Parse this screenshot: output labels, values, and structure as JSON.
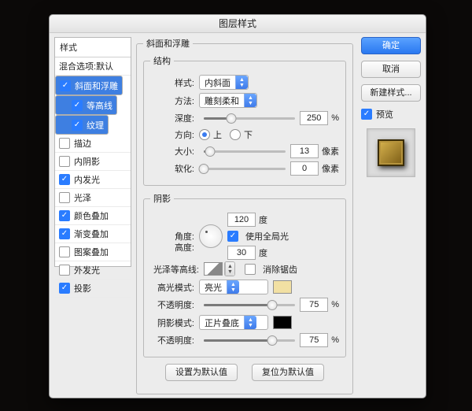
{
  "window": {
    "title": "图层样式"
  },
  "sidepanel": {
    "header": "样式",
    "blend": "混合选项:默认",
    "items": [
      {
        "label": "斜面和浮雕",
        "checked": true,
        "selected": true,
        "indent": false
      },
      {
        "label": "等高线",
        "checked": true,
        "selected": true,
        "indent": true
      },
      {
        "label": "纹理",
        "checked": true,
        "selected": true,
        "indent": true
      },
      {
        "label": "描边",
        "checked": false,
        "selected": false,
        "indent": false
      },
      {
        "label": "内阴影",
        "checked": false,
        "selected": false,
        "indent": false
      },
      {
        "label": "内发光",
        "checked": true,
        "selected": false,
        "indent": false
      },
      {
        "label": "光泽",
        "checked": false,
        "selected": false,
        "indent": false
      },
      {
        "label": "颜色叠加",
        "checked": true,
        "selected": false,
        "indent": false
      },
      {
        "label": "渐变叠加",
        "checked": true,
        "selected": false,
        "indent": false
      },
      {
        "label": "图案叠加",
        "checked": false,
        "selected": false,
        "indent": false
      },
      {
        "label": "外发光",
        "checked": false,
        "selected": false,
        "indent": false
      },
      {
        "label": "投影",
        "checked": true,
        "selected": false,
        "indent": false
      }
    ]
  },
  "actions": {
    "ok": "确定",
    "cancel": "取消",
    "newstyle": "新建样式...",
    "preview_label": "预览",
    "preview_checked": true
  },
  "structure": {
    "legend": "结构",
    "style_label": "样式:",
    "style_value": "内斜面",
    "technique_label": "方法:",
    "technique_value": "雕刻柔和",
    "depth_label": "深度:",
    "depth_value": "250",
    "depth_unit": "%",
    "depth_fill": 30,
    "direction_label": "方向:",
    "dir_up": "上",
    "dir_down": "下",
    "dir_sel": "up",
    "size_label": "大小:",
    "size_value": "13",
    "size_unit": "像素",
    "size_fill": 8,
    "soften_label": "软化:",
    "soften_value": "0",
    "soften_unit": "像素",
    "soften_fill": 0
  },
  "shading": {
    "legend": "阴影",
    "angle_label": "角度:",
    "angle_value": "120",
    "angle_unit": "度",
    "globallight_label": "使用全局光",
    "globallight_checked": true,
    "altitude_label": "高度:",
    "altitude_value": "30",
    "altitude_unit": "度",
    "gloss_label": "光泽等高线:",
    "antialias_label": "消除锯齿",
    "antialias_checked": false,
    "highlight_mode_label": "高光模式:",
    "highlight_mode_value": "亮光",
    "highlight_opacity_label": "不透明度:",
    "highlight_opacity_value": "75",
    "opacity_unit": "%",
    "highlight_fill": 75,
    "shadow_mode_label": "阴影模式:",
    "shadow_mode_value": "正片叠底",
    "shadow_opacity_label": "不透明度:",
    "shadow_opacity_value": "75",
    "shadow_fill": 75
  },
  "footer": {
    "make_default": "设置为默认值",
    "reset_default": "复位为默认值"
  },
  "group_title": "斜面和浮雕"
}
